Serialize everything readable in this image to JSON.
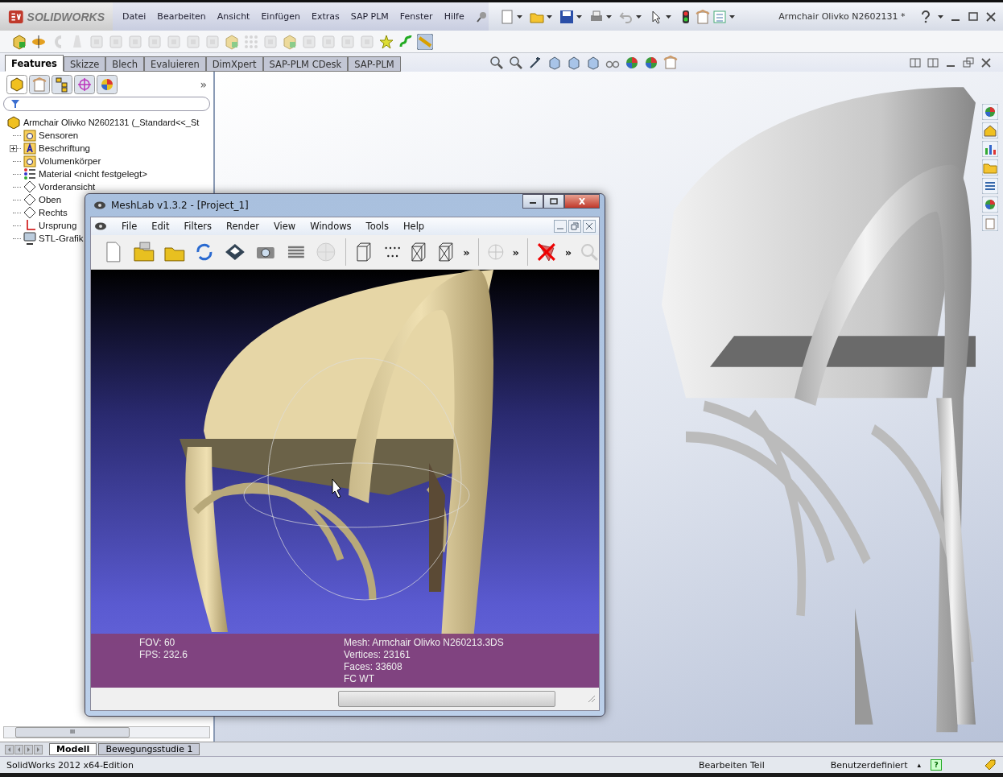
{
  "window": {
    "logo": "SOLIDWORKS",
    "menu": [
      "Datei",
      "Bearbeiten",
      "Ansicht",
      "Einfügen",
      "Extras",
      "SAP PLM",
      "Fenster",
      "Hilfe"
    ],
    "document_title": "Armchair Olivko N2602131 *"
  },
  "command_tabs": [
    {
      "label": "Features",
      "selected": true
    },
    {
      "label": "Skizze",
      "selected": false
    },
    {
      "label": "Blech",
      "selected": false
    },
    {
      "label": "Evaluieren",
      "selected": false
    },
    {
      "label": "DimXpert",
      "selected": false
    },
    {
      "label": "SAP-PLM CDesk",
      "selected": false
    },
    {
      "label": "SAP-PLM",
      "selected": false
    }
  ],
  "feature_tree": {
    "more": "»",
    "root": "Armchair Olivko N2602131  (_Standard<<_St",
    "items": [
      {
        "label": "Sensoren",
        "kind": "folder",
        "expandable": false
      },
      {
        "label": "Beschriftung",
        "kind": "annotation",
        "expandable": true
      },
      {
        "label": "Volumenkörper",
        "kind": "folder",
        "expandable": false
      },
      {
        "label": "Material <nicht festgelegt>",
        "kind": "material",
        "expandable": false
      },
      {
        "label": "Vorderansicht",
        "kind": "plane",
        "expandable": false
      },
      {
        "label": "Oben",
        "kind": "plane",
        "expandable": false
      },
      {
        "label": "Rechts",
        "kind": "plane",
        "expandable": false
      },
      {
        "label": "Ursprung",
        "kind": "origin",
        "expandable": false
      },
      {
        "label": "STL-Grafik",
        "kind": "monitor",
        "expandable": false
      }
    ]
  },
  "meshlab": {
    "title": "MeshLab v1.3.2 - [Project_1]",
    "menu": [
      "File",
      "Edit",
      "Filters",
      "Render",
      "View",
      "Windows",
      "Tools",
      "Help"
    ],
    "more": [
      "»",
      "»",
      "»"
    ],
    "info_left": [
      "FOV: 60",
      "FPS:   232.6"
    ],
    "info_right": [
      "Mesh: Armchair Olivko N260213.3DS",
      "Vertices: 23161",
      "Faces: 33608",
      "FC WT"
    ]
  },
  "bottom_tabs": [
    {
      "label": "Modell",
      "selected": true
    },
    {
      "label": "Bewegungsstudie 1",
      "selected": false
    }
  ],
  "scrollbar": {
    "grip": "III"
  },
  "status_bar": {
    "product": "SolidWorks 2012 x64-Edition",
    "mode": "Bearbeiten Teil",
    "units": "Benutzerdefiniert",
    "units_arrow": "▴",
    "help": "?"
  }
}
